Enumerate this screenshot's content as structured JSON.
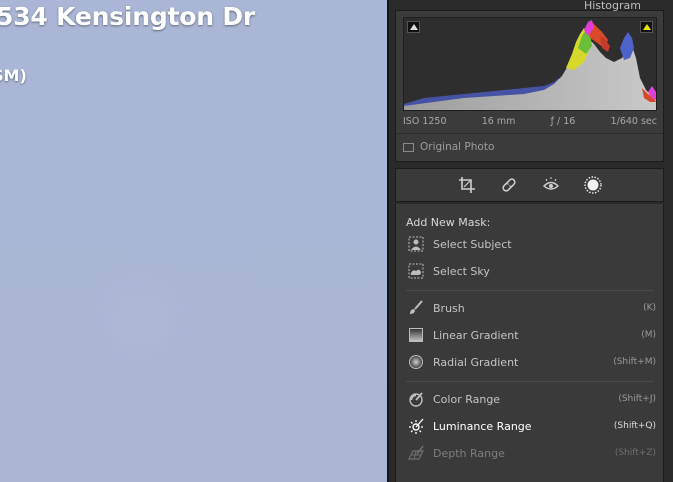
{
  "photo": {
    "title": "534 Kensington Dr",
    "subtitle": "SM)"
  },
  "histogram": {
    "header": "Histogram",
    "iso": "ISO 1250",
    "focal": "16 mm",
    "aperture": "ƒ / 16",
    "shutter": "1/640 sec",
    "original_label": "Original Photo"
  },
  "tools": [
    {
      "name": "crop-icon"
    },
    {
      "name": "healing-icon"
    },
    {
      "name": "red-eye-icon"
    },
    {
      "name": "masking-icon"
    }
  ],
  "mask_panel": {
    "title": "Add New Mask:",
    "groups": [
      [
        {
          "label": "Select Subject",
          "shortcut": "",
          "icon": "subject-icon",
          "state": "normal"
        },
        {
          "label": "Select Sky",
          "shortcut": "",
          "icon": "sky-icon",
          "state": "normal"
        }
      ],
      [
        {
          "label": "Brush",
          "shortcut": "(K)",
          "icon": "brush-icon",
          "state": "normal"
        },
        {
          "label": "Linear Gradient",
          "shortcut": "(M)",
          "icon": "linear-gradient-icon",
          "state": "normal"
        },
        {
          "label": "Radial Gradient",
          "shortcut": "(Shift+M)",
          "icon": "radial-gradient-icon",
          "state": "normal"
        }
      ],
      [
        {
          "label": "Color Range",
          "shortcut": "(Shift+J)",
          "icon": "color-range-icon",
          "state": "normal"
        },
        {
          "label": "Luminance Range",
          "shortcut": "(Shift+Q)",
          "icon": "luminance-range-icon",
          "state": "active"
        },
        {
          "label": "Depth Range",
          "shortcut": "(Shift+Z)",
          "icon": "depth-range-icon",
          "state": "disabled"
        }
      ]
    ]
  }
}
